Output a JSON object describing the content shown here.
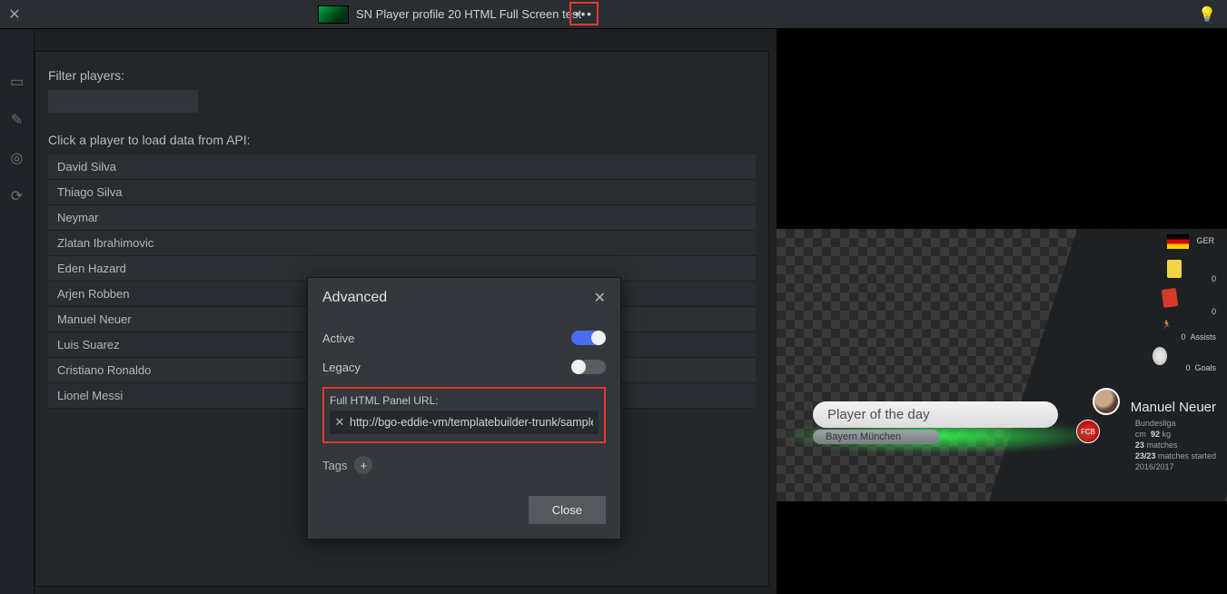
{
  "topbar": {
    "tab_title": "SN Player profile 20 HTML Full Screen test",
    "more": "•••"
  },
  "panel": {
    "filter_label": "Filter players:",
    "api_label": "Click a player to load data from API:",
    "players": [
      "David Silva",
      "Thiago Silva",
      "Neymar",
      "Zlatan Ibrahimovic",
      "Eden Hazard",
      "Arjen Robben",
      "Manuel Neuer",
      "Luis Suarez",
      "Cristiano Ronaldo",
      "Lionel Messi"
    ]
  },
  "modal": {
    "title": "Advanced",
    "active_label": "Active",
    "active_on": true,
    "legacy_label": "Legacy",
    "legacy_on": false,
    "url_label": "Full HTML Panel URL:",
    "url_value": "http://bgo-eddie-vm/templatebuilder-trunk/samples/",
    "tags_label": "Tags",
    "close_label": "Close"
  },
  "preview": {
    "lower_third_title": "Player of the day",
    "lower_third_sub": "Bayern München",
    "flag_code": "GER",
    "yellow_cards": "0",
    "red_cards": "0",
    "assists_value": "0",
    "assists_label": "Assists",
    "goals_value": "0",
    "goals_label": "Goals",
    "player_name": "Manuel Neuer",
    "meta_league": "Bundesliga",
    "meta_height_label": "cm",
    "meta_weight": "92",
    "meta_weight_unit": "kg",
    "meta_matches": "23",
    "meta_matches_label": "matches",
    "meta_started": "23/23",
    "meta_started_label": "matches started",
    "meta_season": "2016/2017"
  }
}
